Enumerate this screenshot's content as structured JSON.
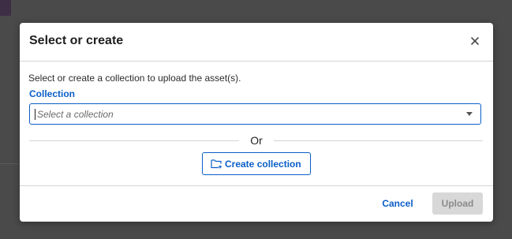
{
  "dialog": {
    "title": "Select or create",
    "description": "Select or create a collection to upload the asset(s).",
    "collection_label": "Collection",
    "collection_select": {
      "placeholder": "Select a collection",
      "selected_value": ""
    },
    "or_text": "Or",
    "create_button_label": "Create collection",
    "cancel_label": "Cancel",
    "upload_label": "Upload",
    "upload_disabled": true,
    "icons": {
      "close": "close-icon",
      "dropdown": "chevron-down-icon",
      "create": "folder-add-icon"
    }
  },
  "colors": {
    "accent": "#0a5ec8",
    "backdrop": "#4a4a4a",
    "disabled_bg": "#d8d8d8",
    "disabled_text": "#8a8a8a"
  }
}
